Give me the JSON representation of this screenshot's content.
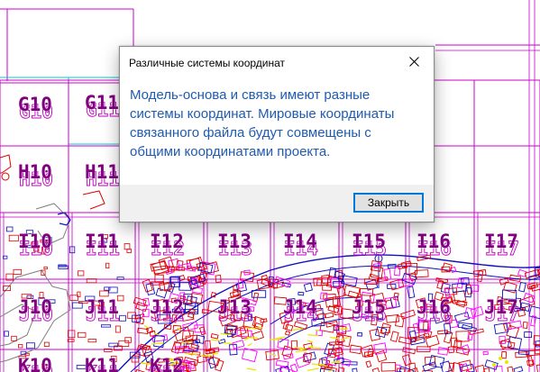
{
  "map": {
    "grid_labels": [
      {
        "id": "g10",
        "text": "G10"
      },
      {
        "id": "g11",
        "text": "G11"
      },
      {
        "id": "h10",
        "text": "H10"
      },
      {
        "id": "h11",
        "text": "H11"
      },
      {
        "id": "i10",
        "text": "I10"
      },
      {
        "id": "i11",
        "text": "I11"
      },
      {
        "id": "i12",
        "text": "I12"
      },
      {
        "id": "i13",
        "text": "I13"
      },
      {
        "id": "i14",
        "text": "I14"
      },
      {
        "id": "i15",
        "text": "I15"
      },
      {
        "id": "i16",
        "text": "I16"
      },
      {
        "id": "i17",
        "text": "I17"
      },
      {
        "id": "j10",
        "text": "J10"
      },
      {
        "id": "j11",
        "text": "J11"
      },
      {
        "id": "j12",
        "text": "J12"
      },
      {
        "id": "j13",
        "text": "J13"
      },
      {
        "id": "j14",
        "text": "J14"
      },
      {
        "id": "j15",
        "text": "J15"
      },
      {
        "id": "j16",
        "text": "J16"
      },
      {
        "id": "j17",
        "text": "J17"
      },
      {
        "id": "k10",
        "text": "K10"
      },
      {
        "id": "k11",
        "text": "K11"
      },
      {
        "id": "k12",
        "text": "K12"
      }
    ],
    "colors": {
      "grid_label": "#800080",
      "grid_line": "#cc00cc",
      "highlight_line": "#00cccc",
      "building_red": "#e00000",
      "building_blue": "#1010c0",
      "building_yellow": "#e8e800",
      "site_gray": "#808080"
    }
  },
  "dialog": {
    "title": "Различные системы координат",
    "message": "Модель-основа и связь имеют разные системы координат. Мировые координаты связанного файла будут совмещены с общими координатами проекта.",
    "close_button_label": "Закрыть",
    "close_icon": "close-icon",
    "message_color": "#1f5bb0",
    "button_focus_color": "#0078d7"
  }
}
